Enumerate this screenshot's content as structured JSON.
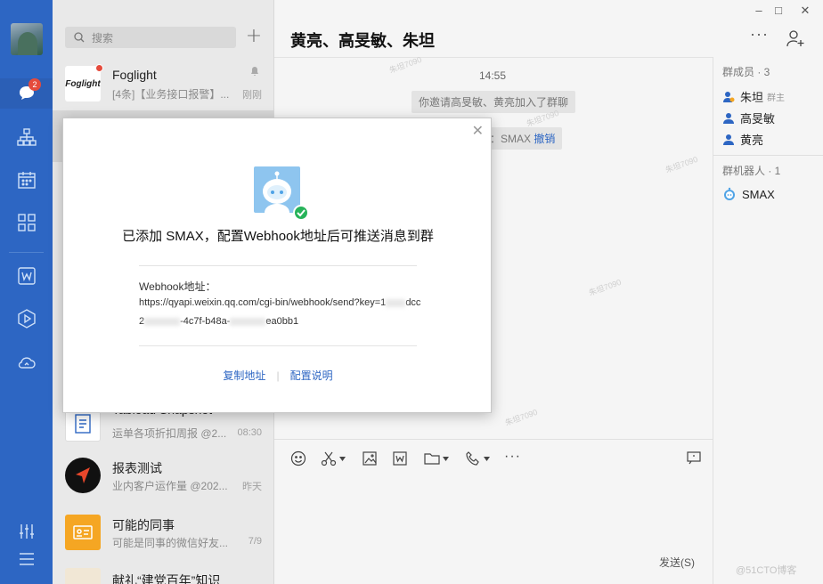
{
  "window": {
    "minimize": "–",
    "maximize": "□",
    "close": "✕"
  },
  "rail": {
    "badge": "2"
  },
  "search": {
    "placeholder": "搜索"
  },
  "conversations": [
    {
      "name": "Foglight",
      "msg": "[4条]【业务接口报警】...",
      "time": "刚刚"
    },
    {
      "name": "Tableau Snapshot",
      "msg": "运单各项折扣周报 @2...",
      "time": "08:30"
    },
    {
      "name": "报表测试",
      "msg": "业内客户运作量 @202...",
      "time": "昨天"
    },
    {
      "name": "可能的同事",
      "msg": "可能是同事的微信好友...",
      "time": "7/9"
    },
    {
      "name": "献礼“建党百年”知识",
      "msg": "",
      "time": ""
    }
  ],
  "chat": {
    "title": "黄亮、高旻敏、朱坦",
    "more": "···",
    "time": "14:55",
    "sys_msg": "你邀请高旻敏、黄亮加入了群聊",
    "sys_msg2_prefix": "人：SMAX",
    "sys_msg2_link": "撤销",
    "send": "发送(S)"
  },
  "members": {
    "header": "群成员 · 3",
    "list": [
      {
        "name": "朱坦",
        "role": "群主"
      },
      {
        "name": "高旻敏",
        "role": ""
      },
      {
        "name": "黄亮",
        "role": ""
      }
    ],
    "robots_header": "群机器人 · 1",
    "robot": "SMAX"
  },
  "modal": {
    "close": "✕",
    "title": "已添加 SMAX，配置Webhook地址后可推送消息到群",
    "webhook_label": "Webhook地址：",
    "url_line1": "https://qyapi.weixin.qq.com/cgi-bin/webhook/send?key=1",
    "url_line1_end": "dcc",
    "url_line2_a": "2",
    "url_line2_b": "-4c7f-b48a-",
    "url_line2_c": "ea0bb1",
    "copy": "复制地址",
    "sep": "|",
    "config": "配置说明"
  },
  "watermarks": [
    "朱坦7090",
    "朱坦7090",
    "朱坦7090",
    "朱坦7090",
    "朱坦7090"
  ],
  "corner_watermark": "@51CTO博客",
  "colors": {
    "rail": "#2d66c3",
    "link": "#2d66c3",
    "badge": "#e54b3c",
    "check": "#27b35a"
  }
}
